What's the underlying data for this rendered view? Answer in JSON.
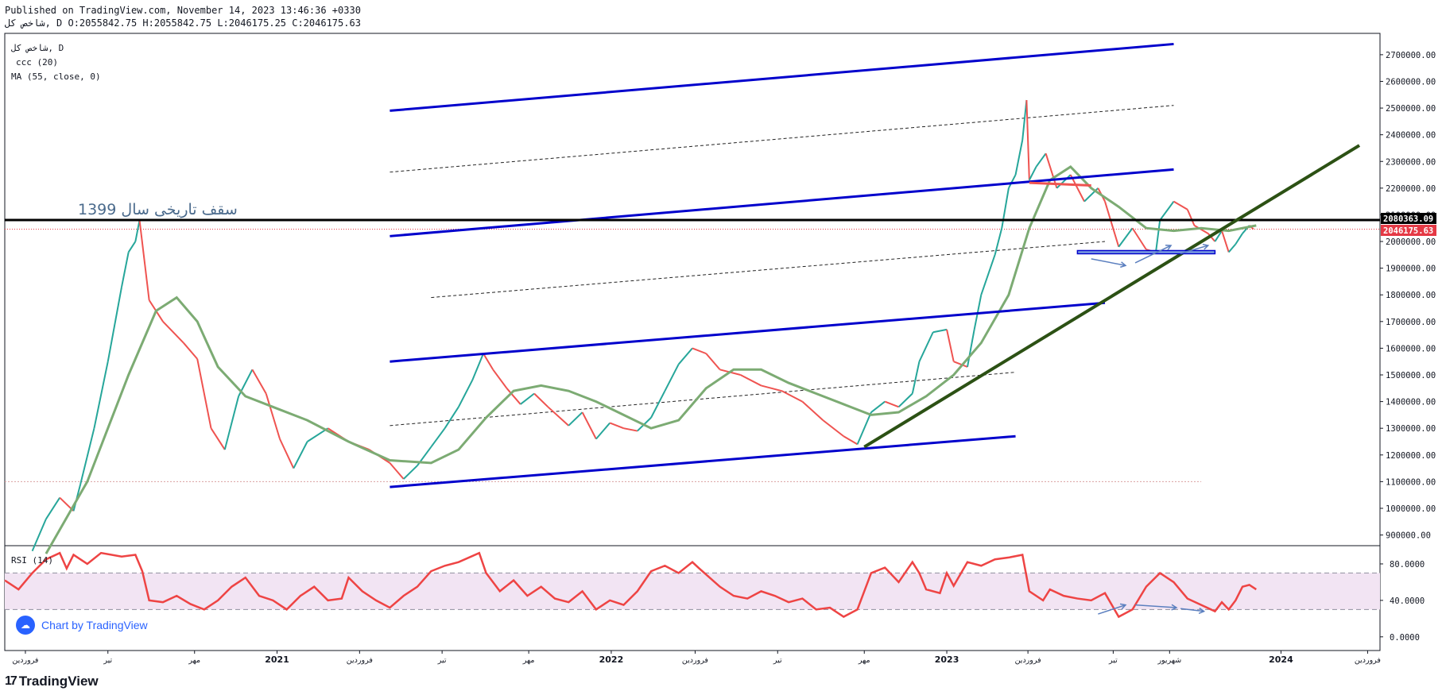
{
  "header": {
    "published": "Published on TradingView.com, November 14, 2023 13:46:36 +0330",
    "ohlc": "شاخص کل, D O:2055842.75 H:2055842.75 L:2046175.25 C:2046175.63"
  },
  "legend": {
    "symbol": "شاخص کل, D",
    "indicator1": "ccc (20)",
    "indicator2": "MA (55, close, 0)",
    "rsi": "RSI (14)"
  },
  "annotation_text": "سقف تاریخی سال 1399",
  "price_tags": {
    "black_line": "2080363.09",
    "last_price": "2046175.63"
  },
  "badge": {
    "label": "Chart by TradingView"
  },
  "footer": {
    "brand": "TradingView"
  },
  "colors": {
    "up": "#26a69a",
    "down": "#ef5350",
    "ma": "#7cab73",
    "channel": "#0000cc",
    "trend": "#2c5114",
    "rsi": "#ee4444",
    "rsi_band": "#f2e4f3",
    "black": "#000000",
    "tag_red": "#e53945"
  },
  "chart_data": {
    "type": "line",
    "price_axis": {
      "ticks": [
        "2700000.00",
        "2600000.00",
        "2500000.00",
        "2400000.00",
        "2300000.00",
        "2200000.00",
        "2100000.00",
        "2000000.00",
        "1900000.00",
        "1800000.00",
        "1700000.00",
        "1600000.00",
        "1500000.00",
        "1400000.00",
        "1300000.00",
        "1200000.00",
        "1100000.00",
        "1000000.00",
        "900000.00"
      ],
      "ylim": [
        860000,
        2780000
      ]
    },
    "rsi_axis": {
      "ticks": [
        "80.0000",
        "40.0000",
        "0.0000"
      ],
      "levels": [
        70,
        30
      ],
      "ylim": [
        -15,
        100
      ]
    },
    "time_axis": {
      "labels": [
        {
          "label": "فروردین",
          "t": 0.015
        },
        {
          "label": "تیر",
          "t": 0.075
        },
        {
          "label": "مهر",
          "t": 0.138
        },
        {
          "label": "2021",
          "t": 0.198
        },
        {
          "label": "فروردین",
          "t": 0.258
        },
        {
          "label": "تیر",
          "t": 0.318
        },
        {
          "label": "مهر",
          "t": 0.381
        },
        {
          "label": "2022",
          "t": 0.441
        },
        {
          "label": "فروردین",
          "t": 0.502
        },
        {
          "label": "تیر",
          "t": 0.562
        },
        {
          "label": "مهر",
          "t": 0.625
        },
        {
          "label": "2023",
          "t": 0.685
        },
        {
          "label": "فروردین",
          "t": 0.744
        },
        {
          "label": "تیر",
          "t": 0.806
        },
        {
          "label": "شهریور",
          "t": 0.847
        },
        {
          "label": "2024",
          "t": 0.928
        },
        {
          "label": "فروردین",
          "t": 0.991
        }
      ]
    },
    "price_series": [
      [
        0.02,
        840000
      ],
      [
        0.03,
        960000
      ],
      [
        0.04,
        1040000
      ],
      [
        0.05,
        990000
      ],
      [
        0.055,
        1090000
      ],
      [
        0.065,
        1300000
      ],
      [
        0.075,
        1550000
      ],
      [
        0.085,
        1830000
      ],
      [
        0.09,
        1960000
      ],
      [
        0.095,
        2000000
      ],
      [
        0.098,
        2080000
      ],
      [
        0.105,
        1780000
      ],
      [
        0.115,
        1700000
      ],
      [
        0.13,
        1620000
      ],
      [
        0.14,
        1560000
      ],
      [
        0.15,
        1300000
      ],
      [
        0.16,
        1220000
      ],
      [
        0.17,
        1420000
      ],
      [
        0.18,
        1520000
      ],
      [
        0.19,
        1430000
      ],
      [
        0.2,
        1260000
      ],
      [
        0.21,
        1150000
      ],
      [
        0.22,
        1250000
      ],
      [
        0.235,
        1300000
      ],
      [
        0.25,
        1250000
      ],
      [
        0.265,
        1220000
      ],
      [
        0.28,
        1170000
      ],
      [
        0.29,
        1110000
      ],
      [
        0.3,
        1160000
      ],
      [
        0.31,
        1230000
      ],
      [
        0.32,
        1300000
      ],
      [
        0.33,
        1380000
      ],
      [
        0.34,
        1480000
      ],
      [
        0.348,
        1580000
      ],
      [
        0.355,
        1520000
      ],
      [
        0.365,
        1450000
      ],
      [
        0.375,
        1390000
      ],
      [
        0.385,
        1430000
      ],
      [
        0.395,
        1380000
      ],
      [
        0.41,
        1310000
      ],
      [
        0.42,
        1360000
      ],
      [
        0.43,
        1260000
      ],
      [
        0.44,
        1320000
      ],
      [
        0.45,
        1300000
      ],
      [
        0.46,
        1290000
      ],
      [
        0.47,
        1340000
      ],
      [
        0.48,
        1440000
      ],
      [
        0.49,
        1540000
      ],
      [
        0.5,
        1600000
      ],
      [
        0.51,
        1580000
      ],
      [
        0.52,
        1520000
      ],
      [
        0.535,
        1500000
      ],
      [
        0.55,
        1460000
      ],
      [
        0.565,
        1440000
      ],
      [
        0.58,
        1400000
      ],
      [
        0.595,
        1330000
      ],
      [
        0.61,
        1270000
      ],
      [
        0.62,
        1240000
      ],
      [
        0.63,
        1360000
      ],
      [
        0.64,
        1400000
      ],
      [
        0.65,
        1380000
      ],
      [
        0.66,
        1430000
      ],
      [
        0.665,
        1550000
      ],
      [
        0.675,
        1660000
      ],
      [
        0.685,
        1670000
      ],
      [
        0.69,
        1550000
      ],
      [
        0.7,
        1530000
      ],
      [
        0.705,
        1670000
      ],
      [
        0.71,
        1800000
      ],
      [
        0.72,
        1950000
      ],
      [
        0.725,
        2050000
      ],
      [
        0.73,
        2200000
      ],
      [
        0.735,
        2250000
      ],
      [
        0.74,
        2380000
      ],
      [
        0.743,
        2530000
      ],
      [
        0.745,
        2230000
      ],
      [
        0.75,
        2280000
      ],
      [
        0.757,
        2330000
      ],
      [
        0.765,
        2200000
      ],
      [
        0.775,
        2250000
      ],
      [
        0.785,
        2150000
      ],
      [
        0.795,
        2200000
      ],
      [
        0.8,
        2150000
      ],
      [
        0.81,
        1980000
      ],
      [
        0.82,
        2050000
      ],
      [
        0.83,
        1970000
      ],
      [
        0.837,
        1960000
      ],
      [
        0.84,
        2080000
      ],
      [
        0.85,
        2150000
      ],
      [
        0.86,
        2120000
      ],
      [
        0.865,
        2060000
      ],
      [
        0.875,
        2030000
      ],
      [
        0.88,
        2000000
      ],
      [
        0.885,
        2040000
      ],
      [
        0.89,
        1960000
      ],
      [
        0.895,
        1990000
      ],
      [
        0.9,
        2030000
      ],
      [
        0.905,
        2060000
      ],
      [
        0.908,
        2046175
      ]
    ],
    "ma_series": [
      [
        0.03,
        830000
      ],
      [
        0.06,
        1100000
      ],
      [
        0.09,
        1500000
      ],
      [
        0.11,
        1740000
      ],
      [
        0.125,
        1790000
      ],
      [
        0.14,
        1700000
      ],
      [
        0.155,
        1530000
      ],
      [
        0.175,
        1420000
      ],
      [
        0.2,
        1370000
      ],
      [
        0.22,
        1330000
      ],
      [
        0.25,
        1250000
      ],
      [
        0.28,
        1180000
      ],
      [
        0.31,
        1170000
      ],
      [
        0.33,
        1220000
      ],
      [
        0.35,
        1340000
      ],
      [
        0.37,
        1440000
      ],
      [
        0.39,
        1460000
      ],
      [
        0.41,
        1440000
      ],
      [
        0.43,
        1400000
      ],
      [
        0.45,
        1350000
      ],
      [
        0.47,
        1300000
      ],
      [
        0.49,
        1330000
      ],
      [
        0.51,
        1450000
      ],
      [
        0.53,
        1520000
      ],
      [
        0.55,
        1520000
      ],
      [
        0.57,
        1470000
      ],
      [
        0.59,
        1430000
      ],
      [
        0.61,
        1390000
      ],
      [
        0.63,
        1350000
      ],
      [
        0.65,
        1360000
      ],
      [
        0.67,
        1420000
      ],
      [
        0.69,
        1500000
      ],
      [
        0.71,
        1620000
      ],
      [
        0.73,
        1800000
      ],
      [
        0.745,
        2050000
      ],
      [
        0.76,
        2230000
      ],
      [
        0.775,
        2280000
      ],
      [
        0.79,
        2200000
      ],
      [
        0.81,
        2130000
      ],
      [
        0.83,
        2050000
      ],
      [
        0.85,
        2040000
      ],
      [
        0.87,
        2050000
      ],
      [
        0.89,
        2040000
      ],
      [
        0.91,
        2060000
      ]
    ],
    "rsi_series": [
      [
        0.0,
        62
      ],
      [
        0.01,
        52
      ],
      [
        0.02,
        70
      ],
      [
        0.03,
        85
      ],
      [
        0.04,
        92
      ],
      [
        0.045,
        75
      ],
      [
        0.05,
        90
      ],
      [
        0.06,
        80
      ],
      [
        0.07,
        92
      ],
      [
        0.085,
        88
      ],
      [
        0.095,
        90
      ],
      [
        0.1,
        72
      ],
      [
        0.105,
        40
      ],
      [
        0.115,
        38
      ],
      [
        0.125,
        45
      ],
      [
        0.135,
        36
      ],
      [
        0.145,
        30
      ],
      [
        0.155,
        40
      ],
      [
        0.165,
        55
      ],
      [
        0.175,
        65
      ],
      [
        0.185,
        45
      ],
      [
        0.195,
        40
      ],
      [
        0.205,
        30
      ],
      [
        0.215,
        45
      ],
      [
        0.225,
        55
      ],
      [
        0.235,
        40
      ],
      [
        0.245,
        42
      ],
      [
        0.25,
        65
      ],
      [
        0.26,
        50
      ],
      [
        0.27,
        40
      ],
      [
        0.28,
        32
      ],
      [
        0.29,
        45
      ],
      [
        0.3,
        55
      ],
      [
        0.31,
        72
      ],
      [
        0.32,
        78
      ],
      [
        0.33,
        82
      ],
      [
        0.345,
        92
      ],
      [
        0.35,
        70
      ],
      [
        0.36,
        50
      ],
      [
        0.37,
        62
      ],
      [
        0.38,
        45
      ],
      [
        0.39,
        55
      ],
      [
        0.4,
        42
      ],
      [
        0.41,
        38
      ],
      [
        0.42,
        50
      ],
      [
        0.43,
        30
      ],
      [
        0.44,
        40
      ],
      [
        0.45,
        35
      ],
      [
        0.46,
        50
      ],
      [
        0.47,
        72
      ],
      [
        0.48,
        78
      ],
      [
        0.49,
        70
      ],
      [
        0.5,
        82
      ],
      [
        0.505,
        75
      ],
      [
        0.52,
        55
      ],
      [
        0.53,
        45
      ],
      [
        0.54,
        42
      ],
      [
        0.55,
        50
      ],
      [
        0.56,
        45
      ],
      [
        0.57,
        38
      ],
      [
        0.58,
        42
      ],
      [
        0.59,
        30
      ],
      [
        0.6,
        32
      ],
      [
        0.61,
        22
      ],
      [
        0.62,
        30
      ],
      [
        0.63,
        70
      ],
      [
        0.64,
        76
      ],
      [
        0.65,
        60
      ],
      [
        0.66,
        82
      ],
      [
        0.665,
        70
      ],
      [
        0.67,
        52
      ],
      [
        0.68,
        48
      ],
      [
        0.685,
        70
      ],
      [
        0.69,
        56
      ],
      [
        0.7,
        82
      ],
      [
        0.71,
        78
      ],
      [
        0.72,
        85
      ],
      [
        0.73,
        87
      ],
      [
        0.74,
        90
      ],
      [
        0.745,
        50
      ],
      [
        0.755,
        40
      ],
      [
        0.76,
        52
      ],
      [
        0.77,
        45
      ],
      [
        0.78,
        42
      ],
      [
        0.79,
        40
      ],
      [
        0.8,
        48
      ],
      [
        0.81,
        22
      ],
      [
        0.82,
        30
      ],
      [
        0.83,
        55
      ],
      [
        0.84,
        70
      ],
      [
        0.85,
        60
      ],
      [
        0.86,
        42
      ],
      [
        0.87,
        35
      ],
      [
        0.88,
        28
      ],
      [
        0.885,
        38
      ],
      [
        0.89,
        30
      ],
      [
        0.895,
        40
      ],
      [
        0.9,
        55
      ],
      [
        0.905,
        57
      ],
      [
        0.91,
        52
      ]
    ],
    "channel_lines": [
      [
        [
          0.28,
          2490000
        ],
        [
          0.85,
          2740000
        ]
      ],
      [
        [
          0.28,
          2020000
        ],
        [
          0.85,
          2270000
        ]
      ],
      [
        [
          0.28,
          1550000
        ],
        [
          0.8,
          1770000
        ]
      ],
      [
        [
          0.28,
          1080000
        ],
        [
          0.735,
          1270000
        ]
      ]
    ],
    "dashed_lines": [
      [
        [
          0.28,
          2260000
        ],
        [
          0.85,
          2510000
        ]
      ],
      [
        [
          0.31,
          1790000
        ],
        [
          0.8,
          2000000
        ]
      ],
      [
        [
          0.28,
          1310000
        ],
        [
          0.735,
          1510000
        ]
      ]
    ],
    "trend_line": [
      [
        0.625,
        1230000
      ],
      [
        0.985,
        2360000
      ]
    ],
    "black_hline": 2080363,
    "red_box": [
      [
        0.745,
        2220000
      ],
      [
        0.79,
        2210000
      ]
    ],
    "support_box": [
      [
        0.78,
        1960000
      ],
      [
        0.88,
        1960000
      ]
    ],
    "price_arrows": [
      [
        [
          0.79,
          1935000
        ],
        [
          0.815,
          1910000
        ]
      ],
      [
        [
          0.822,
          1920000
        ],
        [
          0.848,
          1985000
        ]
      ],
      [
        [
          0.855,
          1955000
        ],
        [
          0.875,
          1985000
        ]
      ]
    ],
    "rsi_arrows": [
      [
        [
          0.795,
          25
        ],
        [
          0.815,
          35
        ]
      ],
      [
        [
          0.822,
          35
        ],
        [
          0.852,
          32
        ]
      ],
      [
        [
          0.855,
          31
        ],
        [
          0.872,
          28
        ]
      ]
    ]
  }
}
